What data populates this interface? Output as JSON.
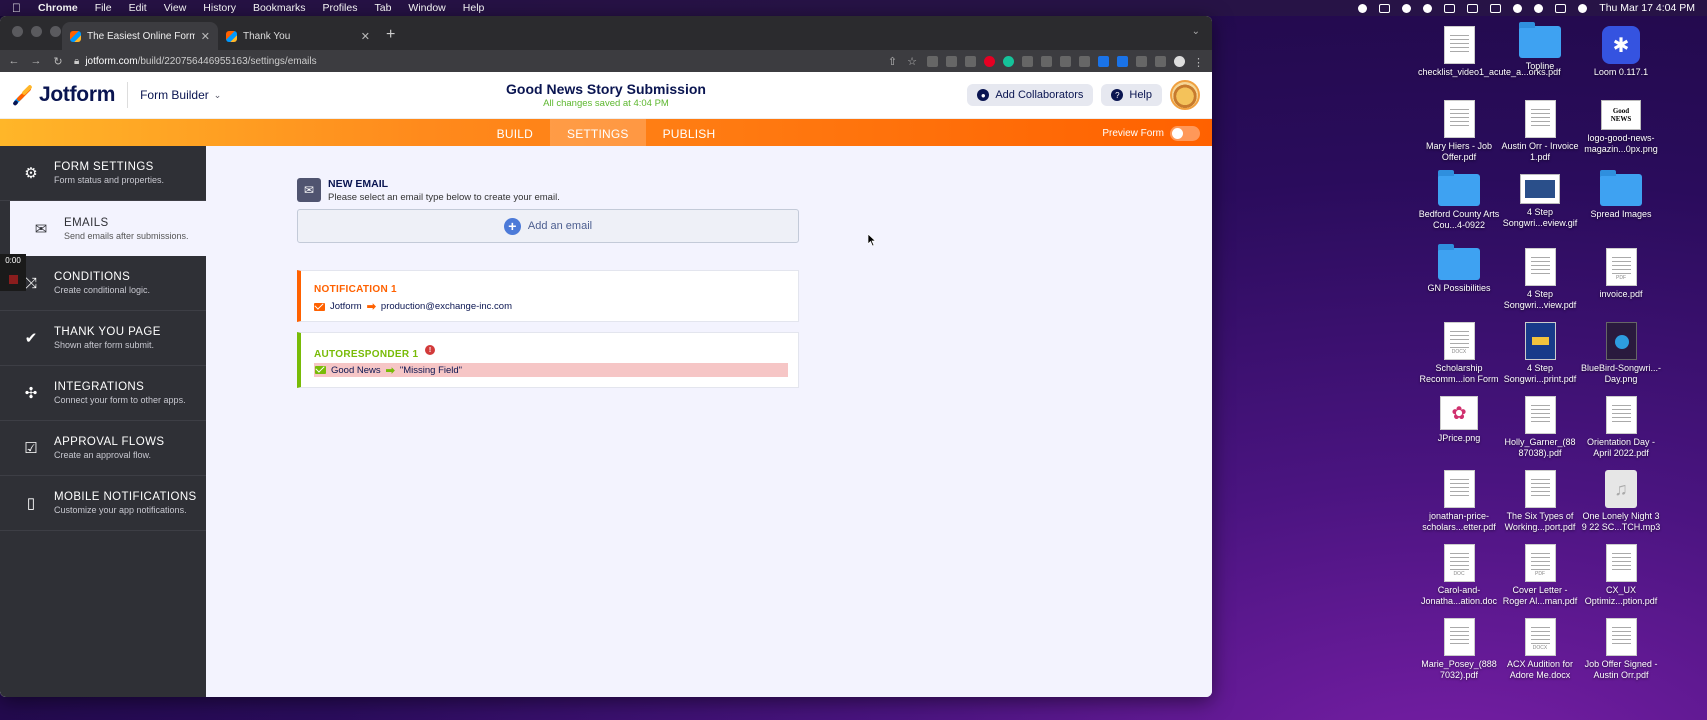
{
  "menubar": {
    "items": [
      "Chrome",
      "File",
      "Edit",
      "View",
      "History",
      "Bookmarks",
      "Profiles",
      "Tab",
      "Window",
      "Help"
    ],
    "clock": "Thu Mar 17  4:04 PM"
  },
  "browser": {
    "tabs": [
      {
        "title": "The Easiest Online Form Builder",
        "icon": "jotform-favicon"
      },
      {
        "title": "Thank You",
        "icon": "jotform-favicon"
      }
    ],
    "new_tab": "+",
    "url_domain": "jotform.com",
    "url_path": "/build/220756446955163/settings/emails"
  },
  "jotform": {
    "logo_text": "Jotform",
    "builder_label": "Form Builder",
    "form_title": "Good News Story Submission",
    "saved_status": "All changes saved at 4:04 PM",
    "collaborators_label": "Add Collaborators",
    "help_label": "Help",
    "nav": [
      "BUILD",
      "SETTINGS",
      "PUBLISH"
    ],
    "active_nav": "SETTINGS",
    "preview_label": "Preview Form",
    "sidebar": [
      {
        "title": "FORM SETTINGS",
        "subtitle": "Form status and properties.",
        "icon": "gear-icon"
      },
      {
        "title": "EMAILS",
        "subtitle": "Send emails after submissions.",
        "icon": "envelope-icon"
      },
      {
        "title": "CONDITIONS",
        "subtitle": "Create conditional logic.",
        "icon": "conditions-icon"
      },
      {
        "title": "THANK YOU PAGE",
        "subtitle": "Shown after form submit.",
        "icon": "check-circle-icon"
      },
      {
        "title": "INTEGRATIONS",
        "subtitle": "Connect your form to other apps.",
        "icon": "puzzle-icon"
      },
      {
        "title": "APPROVAL FLOWS",
        "subtitle": "Create an approval flow.",
        "icon": "approval-icon"
      },
      {
        "title": "MOBILE NOTIFICATIONS",
        "subtitle": "Customize your app notifications.",
        "icon": "mobile-icon"
      }
    ],
    "recording_time": "0:00",
    "new_email": {
      "title": "NEW EMAIL",
      "subtitle": "Please select an email type below to create your email."
    },
    "add_email_label": "Add an email",
    "notification": {
      "title": "NOTIFICATION 1",
      "from": "Jotform",
      "to": "production@exchange-inc.com"
    },
    "autoresponder": {
      "title": "AUTORESPONDER 1",
      "from": "Good News",
      "to": "\"Missing Field\""
    }
  },
  "desktop": [
    {
      "label": "checklist_video1_acute_a...orks.pdf",
      "kind": "doc"
    },
    {
      "label": "Topline",
      "kind": "folder"
    },
    {
      "label": "Loom 0.117.1",
      "kind": "app"
    },
    {
      "label": "Mary Hiers - Job Offer.pdf",
      "kind": "doc"
    },
    {
      "label": "Austin Orr - Invoice 1.pdf",
      "kind": "doc"
    },
    {
      "label": "logo-good-news-magazin...0px.png",
      "kind": "logo",
      "art_text": "Good NEWS"
    },
    {
      "label": "Bedford County Arts Cou...4-0922",
      "kind": "folder"
    },
    {
      "label": "4 Step Songwri...eview.gif",
      "kind": "wide"
    },
    {
      "label": "Spread Images",
      "kind": "folder"
    },
    {
      "label": "GN Possibilities",
      "kind": "folder"
    },
    {
      "label": "4 Step Songwri...view.pdf",
      "kind": "doc"
    },
    {
      "label": "invoice.pdf",
      "kind": "doc",
      "tag": "PDF"
    },
    {
      "label": "Scholarship Recomm...ion Form",
      "kind": "doc",
      "tag": "DOCX"
    },
    {
      "label": "4 Step Songwri...print.pdf",
      "kind": "bluebook"
    },
    {
      "label": "BlueBird-Songwri...-Day.png",
      "kind": "darkbook"
    },
    {
      "label": "JPrice.png",
      "kind": "pink"
    },
    {
      "label": "Holly_Garner_(88 87038).pdf",
      "kind": "doc"
    },
    {
      "label": "Orientation Day - April 2022.pdf",
      "kind": "doc"
    },
    {
      "label": "jonathan-price-scholars...etter.pdf",
      "kind": "doc"
    },
    {
      "label": "The Six Types of Working...port.pdf",
      "kind": "doc"
    },
    {
      "label": "One Lonely Night 3 9 22 SC...TCH.mp3",
      "kind": "audio"
    },
    {
      "label": "Carol-and-Jonatha...ation.doc",
      "kind": "doc",
      "tag": "DOC"
    },
    {
      "label": "Cover Letter - Roger Al...man.pdf",
      "kind": "doc",
      "tag": "PDF"
    },
    {
      "label": "CX_UX Optimiz...ption.pdf",
      "kind": "doc"
    },
    {
      "label": "Marie_Posey_(888 7032).pdf",
      "kind": "doc"
    },
    {
      "label": "ACX Audition for Adore Me.docx",
      "kind": "doc",
      "tag": "DOCX"
    },
    {
      "label": "Job Offer Signed - Austin Orr.pdf",
      "kind": "doc"
    }
  ]
}
